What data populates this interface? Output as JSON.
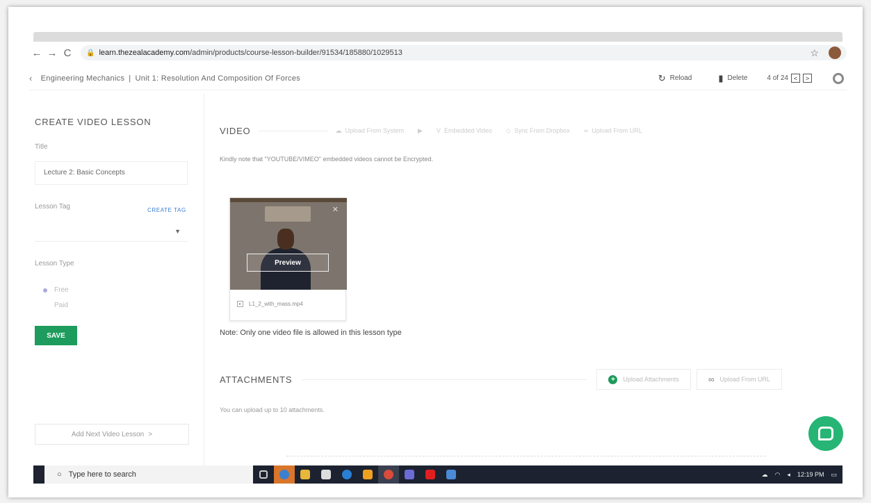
{
  "browser": {
    "url_host": "learn.thezealacademy.com",
    "url_path": "/admin/products/course-lesson-builder/91534/185880/1029513"
  },
  "header": {
    "breadcrumb": [
      "Engineering Mechanics",
      "|",
      "Unit 1: Resolution And Composition Of Forces"
    ],
    "reload_label": "Reload",
    "delete_label": "Delete",
    "pager_text": "4 of 24",
    "pager_prev": "<",
    "pager_next": ">"
  },
  "left_panel": {
    "title": "CREATE VIDEO LESSON",
    "title_label": "Title",
    "title_value": "Lecture 2: Basic Concepts",
    "lesson_tag_label": "Lesson Tag",
    "create_tag_label": "CREATE TAG",
    "lesson_type_label": "Lesson Type",
    "lesson_type_options": [
      "Free",
      "Paid"
    ],
    "save_label": "SAVE",
    "next_lesson_label": "Add Next Video Lesson",
    "next_lesson_chevron": ">"
  },
  "video": {
    "heading": "VIDEO",
    "options": [
      "Upload From System",
      "Embedded Video",
      "Sync From Dropbox",
      "Upload From URL"
    ],
    "note": "Kindly note that \"YOUTUBE/VIMEO\" embedded videos cannot be Encrypted.",
    "preview_label": "Preview",
    "filename": "L1_2_with_mass.mp4",
    "only_one_note": "Note: Only one video file is allowed in this lesson type"
  },
  "attachments": {
    "heading": "ATTACHMENTS",
    "upload_label": "Upload Attachments",
    "upload_url_label": "Upload From URL",
    "note": "You can upload up to 10 attachments."
  },
  "taskbar": {
    "search_placeholder": "Type here to search",
    "clock_time": "12:19 PM"
  },
  "colors": {
    "primary_green": "#1e9c5d",
    "chat_green": "#26b574",
    "link_blue": "#3a7bd5"
  }
}
